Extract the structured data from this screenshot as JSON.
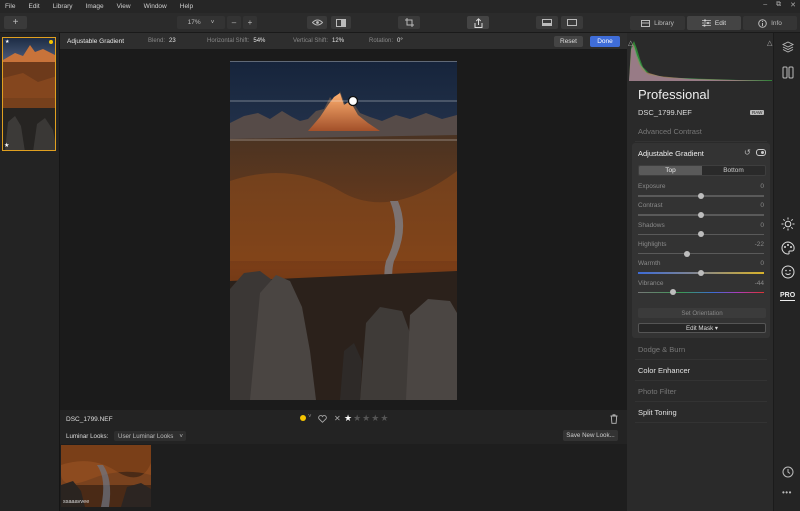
{
  "menu": [
    "File",
    "Edit",
    "Library",
    "Image",
    "View",
    "Window",
    "Help"
  ],
  "window_controls": [
    "–",
    "⧉",
    "✕"
  ],
  "toolbar": {
    "add_label": "+",
    "zoom_value": "17%",
    "zoom_caret": "˅",
    "zoom_out": "–",
    "zoom_in": "+",
    "tabs": {
      "library": "Library",
      "edit": "Edit",
      "info": "Info"
    }
  },
  "adjust_bar": {
    "title": "Adjustable Gradient",
    "blend_label": "Blend:",
    "blend_value": "23",
    "hshift_label": "Horizontal Shift:",
    "hshift_value": "54%",
    "vshift_label": "Vertical Shift:",
    "vshift_value": "12%",
    "rotation_label": "Rotation:",
    "rotation_value": "0°",
    "reset": "Reset",
    "done": "Done"
  },
  "info_bar": {
    "filename": "DSC_1799.NEF",
    "rating": 1,
    "max_rating": 5,
    "reject_glyph": "✕"
  },
  "looks": {
    "label": "Luminar Looks:",
    "selected": "User Luminar Looks",
    "save": "Save New Look...",
    "thumb_caption": "ssaaavvee"
  },
  "panel": {
    "workspace": "Professional",
    "filename": "DSC_1799.NEF",
    "raw_badge": "RAW",
    "sections_top": [
      "Advanced Contrast"
    ],
    "filter_title": "Adjustable Gradient",
    "toggle": {
      "top": "Top",
      "bottom": "Bottom",
      "active": "Top"
    },
    "sliders": [
      {
        "label": "Exposure",
        "value": "0",
        "fraction": 0.5,
        "track": "plain"
      },
      {
        "label": "Contrast",
        "value": "0",
        "fraction": 0.5,
        "track": "plain"
      },
      {
        "label": "Shadows",
        "value": "0",
        "fraction": 0.5,
        "track": "plain"
      },
      {
        "label": "Highlights",
        "value": "-22",
        "fraction": 0.39,
        "track": "plain"
      },
      {
        "label": "Warmth",
        "value": "0",
        "fraction": 0.5,
        "track": "warmth"
      },
      {
        "label": "Vibrance",
        "value": "-44",
        "fraction": 0.28,
        "track": "vibrance"
      }
    ],
    "set_orientation": "Set Orientation",
    "edit_mask": "Edit Mask ▾",
    "sections_bottom": [
      {
        "label": "Dodge & Burn",
        "active": false
      },
      {
        "label": "Color Enhancer",
        "active": true
      },
      {
        "label": "Photo Filter",
        "active": false
      },
      {
        "label": "Split Toning",
        "active": true
      }
    ],
    "pro_badge": "PRO"
  },
  "colors": {
    "accent": "#3f6dd8",
    "thumb_border": "#e0a020",
    "star_on": "#ffffff",
    "star_off": "#555555",
    "dot": "#f5c400"
  }
}
